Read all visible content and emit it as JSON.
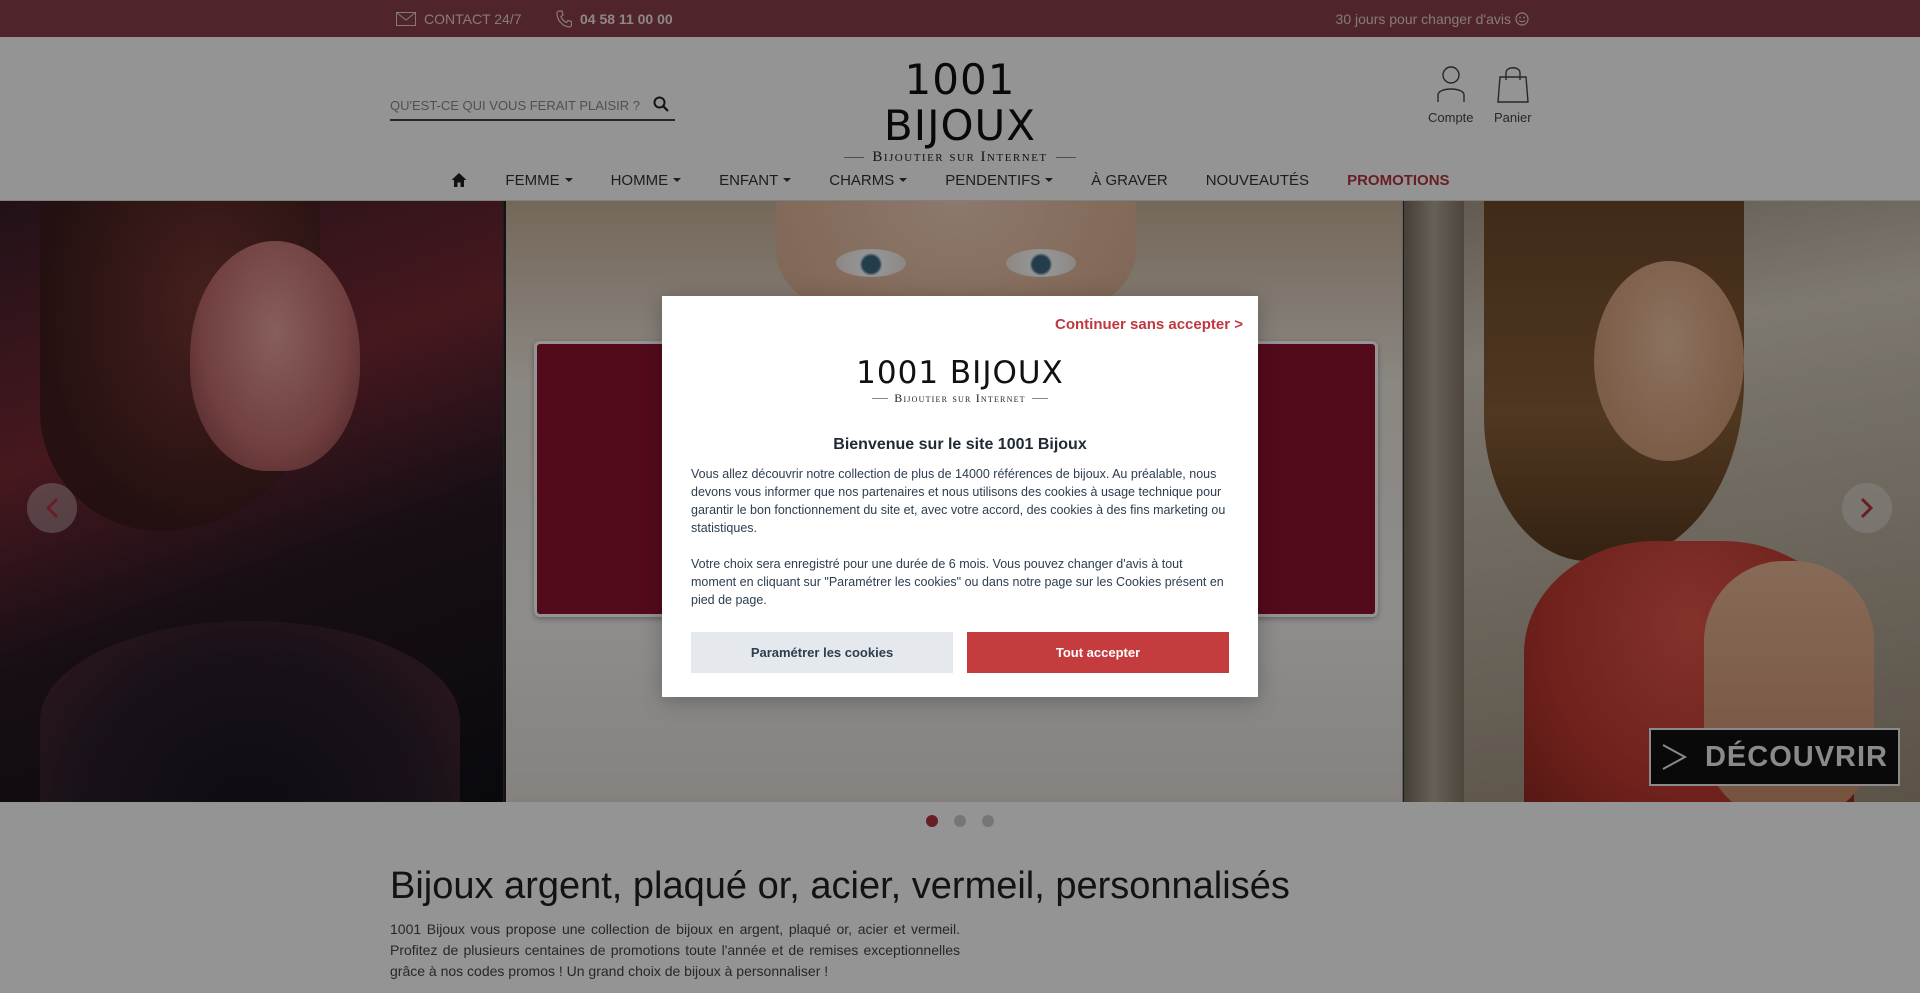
{
  "topbar": {
    "contact_label": "CONTACT 24/7",
    "phone": "04 58 11 00 00",
    "return_policy": "30 jours pour changer d'avis"
  },
  "header": {
    "search_placeholder": "QU'EST-CE QUI VOUS FERAIT PLAISIR ?",
    "logo_main": "1001 BIJOUX",
    "logo_sub": "Bijoutier sur Internet",
    "account_label": "Compte",
    "cart_label": "Panier"
  },
  "nav": {
    "items": [
      {
        "label": "FEMME"
      },
      {
        "label": "HOMME"
      },
      {
        "label": "ENFANT"
      },
      {
        "label": "CHARMS"
      },
      {
        "label": "PENDENTIFS"
      },
      {
        "label": "À GRAVER"
      },
      {
        "label": "NOUVEAUTÉS"
      },
      {
        "label": "PROMOTIONS"
      }
    ]
  },
  "slider": {
    "cta_label": "DÉCOUVRIR",
    "active_dot": 1,
    "dot_count": 3
  },
  "intro": {
    "title": "Bijoux argent, plaqué or, acier, vermeil, personnalisés",
    "text": "1001 Bijoux vous propose une collection de bijoux en argent, plaqué or, acier et vermeil. Profitez de plusieurs centaines de promotions toute l'année et de remises exceptionnelles grâce à nos codes promos ! Un grand choix de bijoux à personnaliser !"
  },
  "cookie_modal": {
    "skip_label": "Continuer sans accepter >",
    "logo_main": "1001 BIJOUX",
    "logo_sub": "Bijoutier sur Internet",
    "title": "Bienvenue sur le site 1001 Bijoux",
    "paragraph1": "Vous allez découvrir notre collection de plus de 14000 références de bijoux. Au préalable, nous devons vous informer que nos partenaires et nous utilisons des cookies à usage technique pour garantir le bon fonctionnement du site et, avec votre accord, des cookies à des fins marketing ou statistiques.",
    "paragraph2": "Votre choix sera enregistré pour une durée de 6 mois. Vous pouvez changer d'avis à tout moment en cliquant sur \"Paramétrer les cookies\" ou dans notre page sur les Cookies présent en pied de page.",
    "settings_button": "Paramétrer les cookies",
    "accept_button": "Tout accepter"
  },
  "colors": {
    "topbar_bg": "#8b3f4a",
    "brand_red": "#c53c3f",
    "promo_red": "#b2343f"
  },
  "icons": {
    "contact": "envelope-icon",
    "phone": "phone-icon",
    "smile": "smile-icon",
    "search": "search-icon",
    "account": "user-icon",
    "cart": "shopping-bag-icon",
    "home": "home-icon",
    "prev": "chevron-left-icon",
    "next": "chevron-right-icon",
    "cta": "arrow-right-icon"
  }
}
